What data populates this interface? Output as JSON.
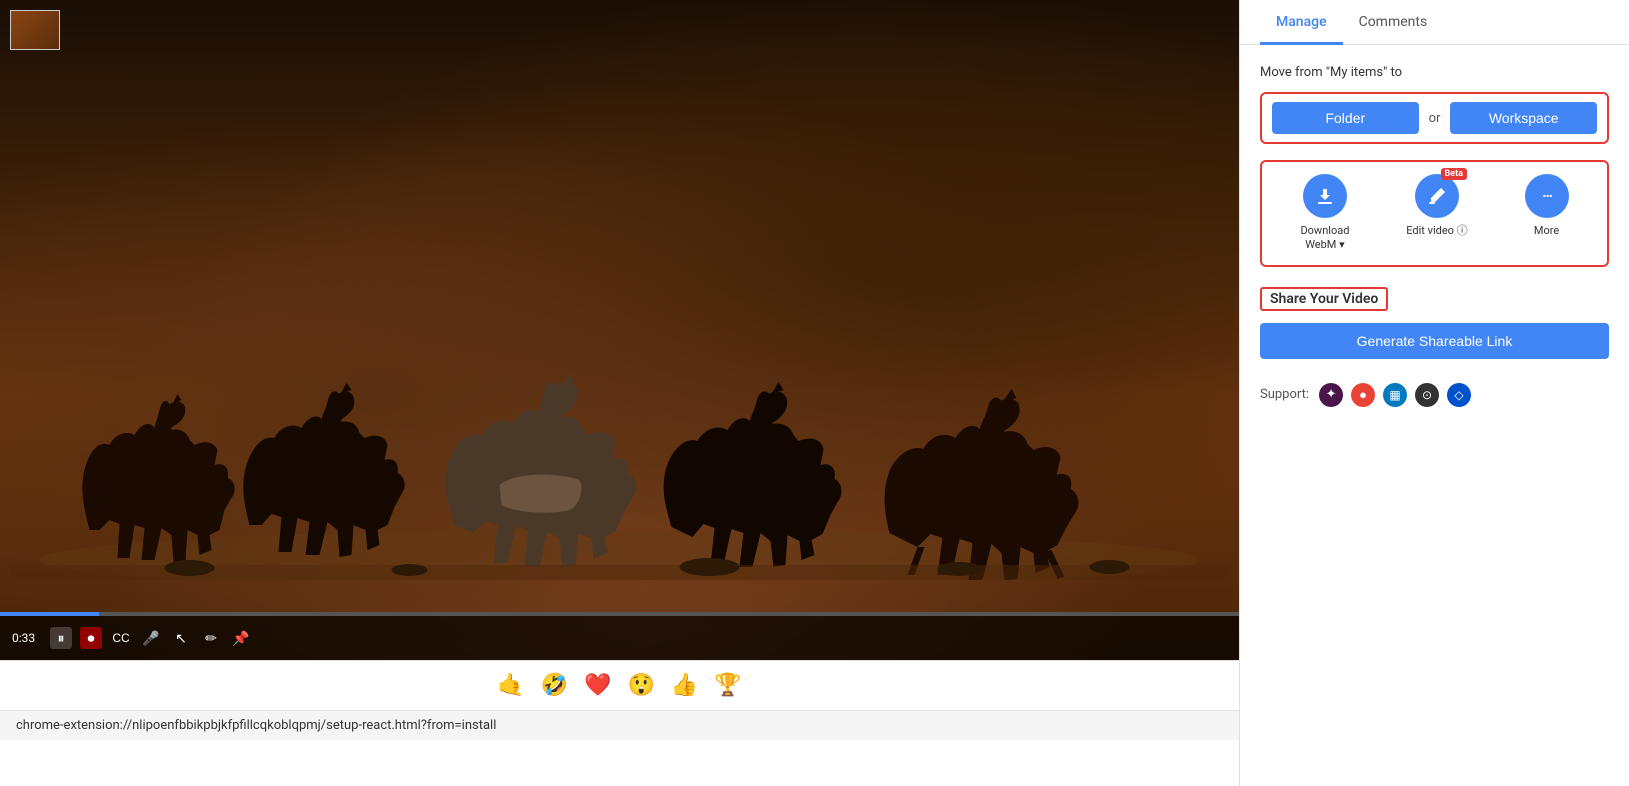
{
  "sidebar": {
    "tabs": [
      {
        "id": "manage",
        "label": "Manage",
        "active": true
      },
      {
        "id": "comments",
        "label": "Comments",
        "active": false
      }
    ],
    "manage": {
      "move_label": "Move from \"My items\" to",
      "folder_btn": "Folder",
      "or_text": "or",
      "workspace_btn": "Workspace",
      "actions": [
        {
          "id": "download",
          "icon": "⬇",
          "label": "Download\nWebM ▾",
          "beta": false
        },
        {
          "id": "edit",
          "icon": "✏",
          "label": "Edit video ⓘ",
          "beta": true
        },
        {
          "id": "more",
          "icon": "•••",
          "label": "More",
          "beta": false
        }
      ],
      "share_title": "Share Your Video",
      "generate_btn": "Generate Shareable Link",
      "support_label": "Support:"
    }
  },
  "video": {
    "time": "0:33",
    "progress_percent": 8,
    "url": "chrome-extension://nlipoenfbbikpbjkfpfillcqkoblqpmj/setup-react.html?from=install"
  },
  "emojis": [
    "🤙",
    "🤣",
    "❤️",
    "😲",
    "👍",
    "🏆"
  ]
}
